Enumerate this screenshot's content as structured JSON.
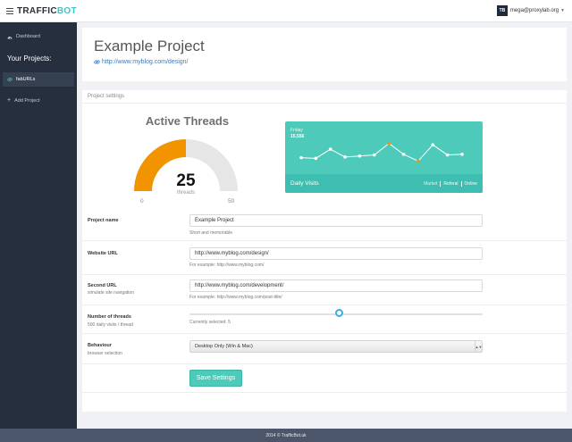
{
  "topbar": {
    "logo_primary": "TRAFFIC",
    "logo_accent": "BOT",
    "user_initials": "TB",
    "user_email": "mega@proxylab.org"
  },
  "sidebar": {
    "dashboard_label": "Dashboard",
    "projects_title": "Your Projects:",
    "projects": [
      {
        "label": "fabURLs",
        "active": true
      }
    ],
    "add_project_label": "Add Project"
  },
  "project": {
    "title": "Example Project",
    "url": "http://www.myblog.com/design/"
  },
  "settings": {
    "heading": "Project settings",
    "gauge": {
      "title": "Active Threads",
      "value": 25,
      "unit": "threads",
      "min": "0",
      "max": "50"
    },
    "visits_chart": {
      "day": "Friday",
      "total": "15,556",
      "label": "Daily Visits",
      "tabs": [
        "Market",
        "Referal",
        "Online"
      ],
      "points": [
        0.3,
        0.28,
        0.55,
        0.32,
        0.35,
        0.38,
        0.72,
        0.4,
        0.2,
        0.68,
        0.38,
        0.4
      ],
      "highlighted_points": [
        6,
        8
      ]
    },
    "fields": {
      "name": {
        "label": "Project name",
        "value": "Example Project",
        "help": "Short and memorable"
      },
      "url": {
        "label": "Website URL",
        "value": "http://www.myblog.com/design/",
        "help": "For example: http://www.myblog.com/"
      },
      "second_url": {
        "label": "Second URL",
        "sub": "simulate site navigation",
        "value": "http://www.myblog.com/development/",
        "help": "For example: http://www.myblog.com/post-title/"
      },
      "threads": {
        "label": "Number of threads",
        "sub": "500 daily visits / thread",
        "help": "Currently selected: 5",
        "level": 0.51
      },
      "behaviour": {
        "label": "Behaviour",
        "sub": "browser selection",
        "value": "Desktop Only (Win & Mac)"
      }
    },
    "save_label": "Save Settings"
  },
  "footer": {
    "text": "2014 © TrafficBot.uk"
  },
  "colors": {
    "accent": "#4dcab9",
    "gauge_fill": "#f29400",
    "gauge_track": "#e6e6e6",
    "sidebar": "#262f3d",
    "footer": "#4b566a",
    "link": "#3b7bbf"
  }
}
